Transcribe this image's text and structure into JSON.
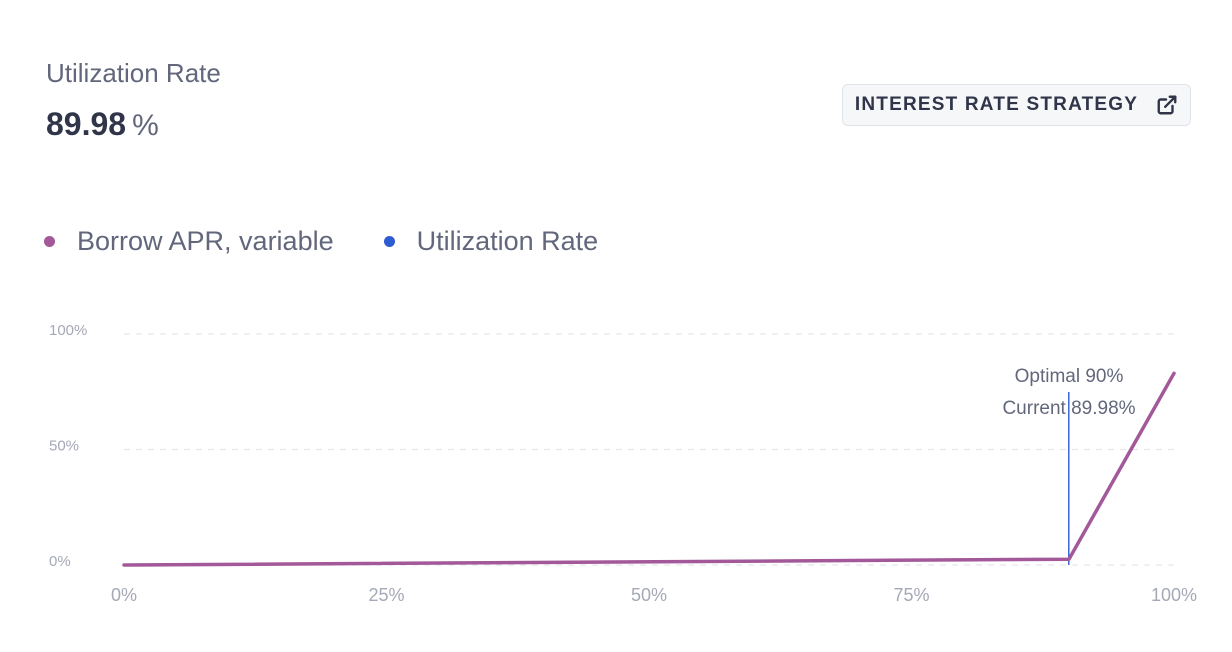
{
  "header": {
    "title": "Utilization Rate",
    "value": "89.98",
    "unit": "%",
    "strategy_button_label": "INTEREST RATE STRATEGY"
  },
  "chart_data": {
    "type": "line",
    "series": [
      {
        "name": "Borrow APR, variable",
        "color": "#a25899",
        "x": [
          0,
          90,
          100
        ],
        "y": [
          0,
          2.5,
          83
        ]
      },
      {
        "name": "Utilization Rate",
        "color": "#2d5bd1"
      }
    ],
    "xlim": [
      0,
      100
    ],
    "ylim": [
      0,
      100
    ],
    "x_ticks": [
      "0%",
      "25%",
      "50%",
      "75%",
      "100%"
    ],
    "y_ticks": [
      "100%",
      "50%",
      "0%"
    ],
    "grid": true,
    "legend_position": "top-left",
    "annotations": {
      "optimal_label": "Optimal 90%",
      "current_label": "Current 89.98%",
      "optimal_x": 90,
      "current_x": 89.98
    }
  }
}
